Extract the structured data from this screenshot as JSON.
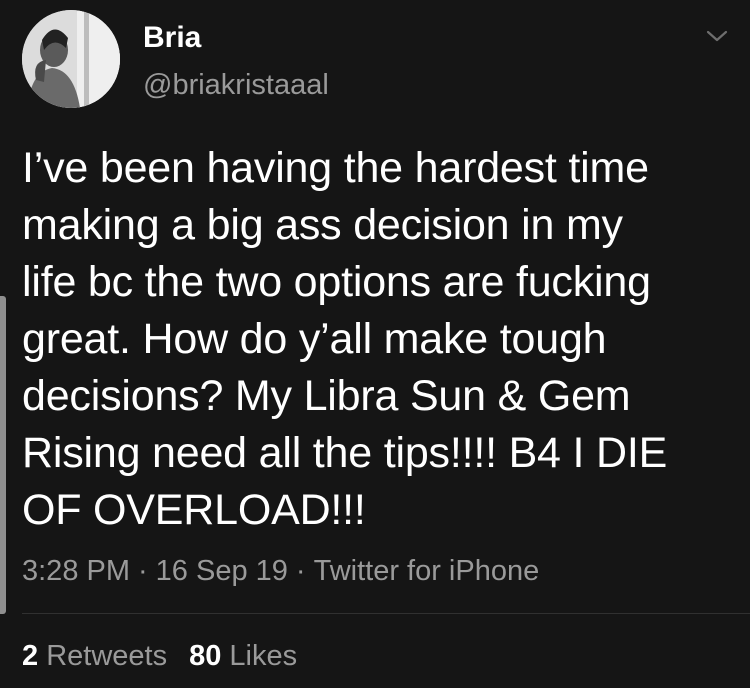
{
  "author": {
    "display_name": "Bria",
    "handle": "@briakristaaal"
  },
  "tweet": {
    "text": "I’ve been having the hardest time\nmaking a big ass decision in my\nlife bc the two options are fucking\ngreat. How do y’all make tough\ndecisions? My Libra Sun & Gem\nRising need all the tips!!!! B4 I DIE\nOF OVERLOAD!!!",
    "time": "3:28 PM",
    "date": "16 Sep 19",
    "source": "Twitter for iPhone",
    "separator": "·"
  },
  "stats": {
    "retweets_count": "2",
    "retweets_label": "Retweets",
    "likes_count": "80",
    "likes_label": "Likes"
  },
  "icons": {
    "menu": "chevron-down-icon",
    "avatar": "profile-photo"
  },
  "colors": {
    "background": "#151515",
    "text_primary": "#ffffff",
    "text_secondary": "#9a9a9a",
    "divider": "#303030"
  }
}
